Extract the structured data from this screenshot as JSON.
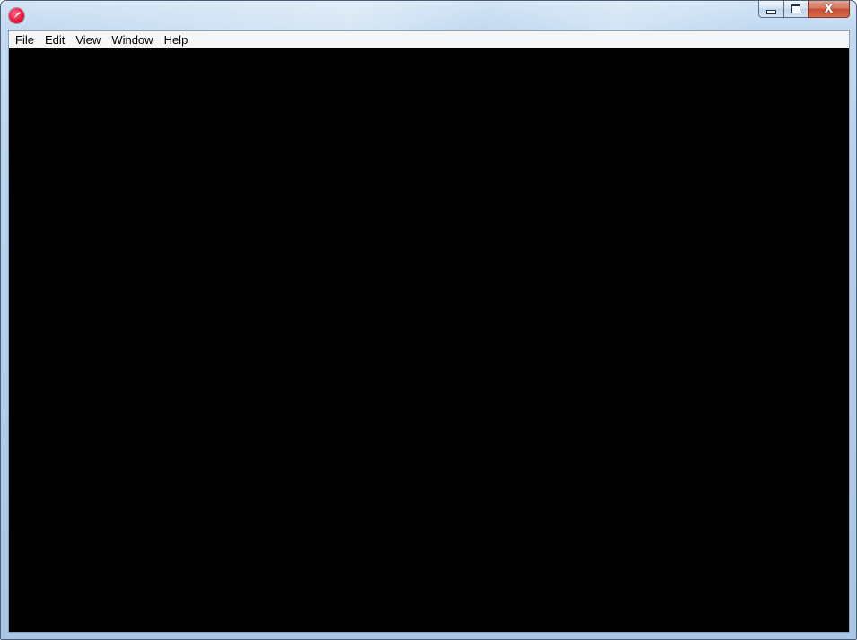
{
  "window": {
    "app_icon": "app-logo-icon",
    "controls": {
      "minimize_icon": "minimize-icon",
      "maximize_icon": "maximize-icon",
      "close_icon": "close-icon",
      "close_glyph": "X"
    }
  },
  "menubar": {
    "items": [
      {
        "label": "File"
      },
      {
        "label": "Edit"
      },
      {
        "label": "View"
      },
      {
        "label": "Window"
      },
      {
        "label": "Help"
      }
    ]
  },
  "colors": {
    "content_background": "#000000",
    "menubar_background": "#f5f6f7",
    "close_button": "#c74f33"
  }
}
